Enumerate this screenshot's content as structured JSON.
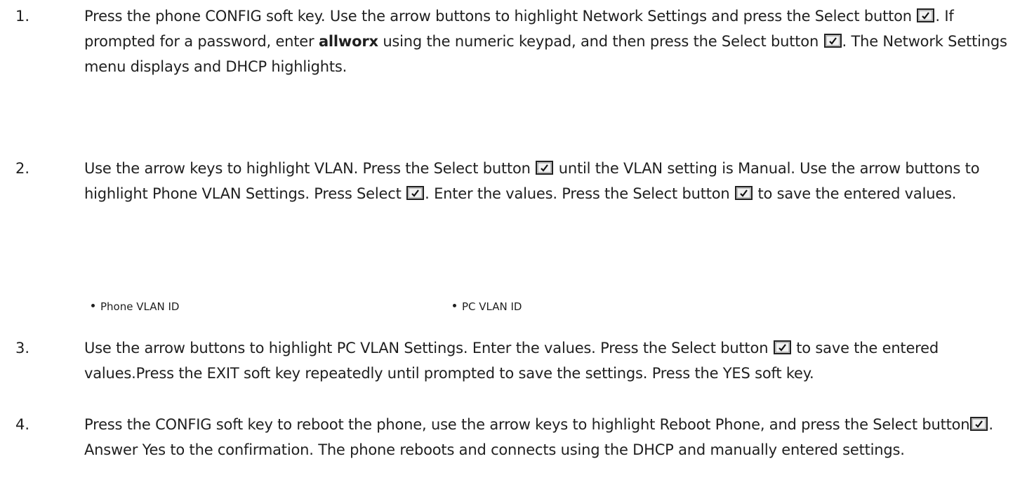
{
  "steps": [
    {
      "number": "1.",
      "parts": [
        "Press the phone CONFIG soft key. Use the arrow buttons to highlight Network Settings and press the Select button ",
        ". If prompted for a password, enter ",
        "allworx",
        " using the numeric keypad, and then press the Select button ",
        ". The Network Settings menu displays and DHCP highlights."
      ]
    },
    {
      "number": "2.",
      "parts": [
        "Use the arrow keys to highlight VLAN. Press the Select button ",
        " until the VLAN setting is Manual. Use the arrow buttons to highlight Phone VLAN Settings. Press Select ",
        ". Enter the values. Press the Select button ",
        " to save the entered values."
      ]
    },
    {
      "number": "3.",
      "parts": [
        "Use the arrow buttons to highlight PC VLAN Settings. Enter the values. Press the Select button ",
        " to save the entered values.Press the EXIT soft key repeatedly until prompted to save the settings. Press the YES soft key."
      ]
    },
    {
      "number": "4.",
      "parts": [
        "Press the CONFIG soft key to reboot the phone, use the arrow keys to highlight Reboot Phone, and press the Select button",
        ". Answer Yes to the confirmation. The phone reboots and connects using the DHCP and manually entered settings."
      ]
    }
  ],
  "bullets": [
    "Phone VLAN ID",
    "PC VLAN ID"
  ],
  "icons": {
    "select_button": "select-checkmark-icon"
  }
}
